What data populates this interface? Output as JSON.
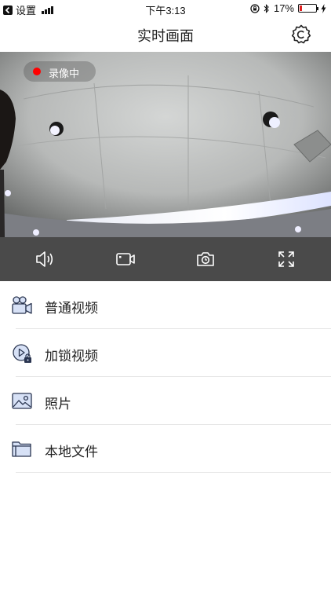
{
  "status_bar": {
    "back_app": "设置",
    "time": "下午3:13",
    "battery_percent": "17%",
    "battery_level": 0.17,
    "icons": [
      "back-icon",
      "signal-icon",
      "orientation-lock-icon",
      "bluetooth-icon",
      "battery-icon",
      "charging-icon"
    ]
  },
  "nav": {
    "title": "实时画面",
    "settings_icon": "settings-icon"
  },
  "video": {
    "recording_label": "录像中",
    "recording_color": "#ff0000"
  },
  "controls": [
    {
      "name": "speaker-icon"
    },
    {
      "name": "record-video-icon"
    },
    {
      "name": "snapshot-icon"
    },
    {
      "name": "fullscreen-icon"
    }
  ],
  "menu": {
    "items": [
      {
        "label": "普通视频",
        "icon": "video-camera-icon"
      },
      {
        "label": "加锁视频",
        "icon": "locked-video-icon"
      },
      {
        "label": "照片",
        "icon": "photo-icon"
      },
      {
        "label": "本地文件",
        "icon": "folder-icon"
      }
    ]
  }
}
